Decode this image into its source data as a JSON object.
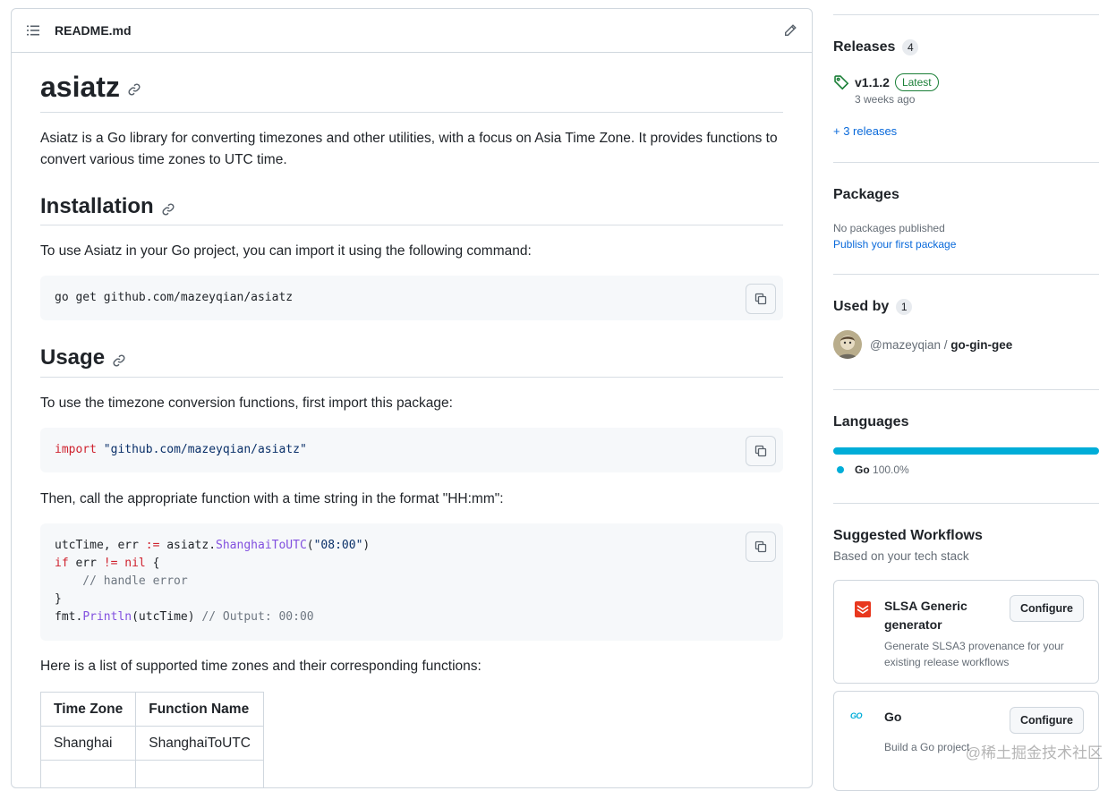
{
  "readme": {
    "filename": "README.md",
    "title": "asiatz",
    "intro": "Asiatz is a Go library for converting timezones and other utilities, with a focus on Asia Time Zone. It provides functions to convert various time zones to UTC time.",
    "installation": {
      "heading": "Installation",
      "text": "To use Asiatz in your Go project, you can import it using the following command:",
      "code": "go get github.com/mazeyqian/asiatz"
    },
    "usage": {
      "heading": "Usage",
      "text1": "To use the timezone conversion functions, first import this package:",
      "import_kw": "import",
      "import_path": "\"github.com/mazeyqian/asiatz\"",
      "text2": "Then, call the appropriate function with a time string in the format \"HH:mm\":",
      "code_lines": {
        "l1_pre": "utcTime, err ",
        "l1_op": ":=",
        "l1_mid": " asiatz.",
        "l1_fn": "ShanghaiToUTC",
        "l1_paren_open": "(",
        "l1_str": "\"08:00\"",
        "l1_paren_close": ")",
        "l2_kw": "if",
        "l2_mid": " err ",
        "l2_op": "!=",
        "l2_sp": " ",
        "l2_nil": "nil",
        "l2_end": " {",
        "l3": "    // handle error",
        "l4": "}",
        "l5_pre": "fmt.",
        "l5_fn": "Println",
        "l5_mid": "(utcTime) ",
        "l5_cm": "// Output: 00:00"
      },
      "text3": "Here is a list of supported time zones and their corresponding functions:"
    },
    "table": {
      "headers": [
        "Time Zone",
        "Function Name"
      ],
      "rows": [
        [
          "Shanghai",
          "ShanghaiToUTC"
        ]
      ]
    }
  },
  "sidebar": {
    "releases": {
      "title": "Releases",
      "count": "4",
      "latest_tag": "v1.1.2",
      "latest_badge": "Latest",
      "latest_time": "3 weeks ago",
      "more": "+ 3 releases"
    },
    "packages": {
      "title": "Packages",
      "none": "No packages published",
      "publish": "Publish your first package"
    },
    "used_by": {
      "title": "Used by",
      "count": "1",
      "owner": "@mazeyqian",
      "separator": " / ",
      "repo": "go-gin-gee"
    },
    "languages": {
      "title": "Languages",
      "items": [
        {
          "name": "Go",
          "percent": "100.0%",
          "color": "#00add8",
          "share": 1.0
        }
      ]
    },
    "workflows": {
      "title": "Suggested Workflows",
      "subtitle": "Based on your tech stack",
      "items": [
        {
          "name_line1": "SLSA Generic",
          "name_line2": "generator",
          "desc_line1": "Generate SLSA3 provenance for your",
          "desc_line2": "existing release workflows",
          "button": "Configure",
          "icon": "slsa-icon"
        },
        {
          "name": "Go",
          "icon_text": "GO",
          "desc": "Build a Go project",
          "button": "Configure",
          "icon": "go-icon"
        }
      ]
    }
  },
  "watermark": "@稀土掘金技术社区",
  "colors": {
    "link": "#0969da",
    "go_language": "#00add8",
    "latest_green": "#1a7f37",
    "slsa_red": "#e8381e"
  }
}
